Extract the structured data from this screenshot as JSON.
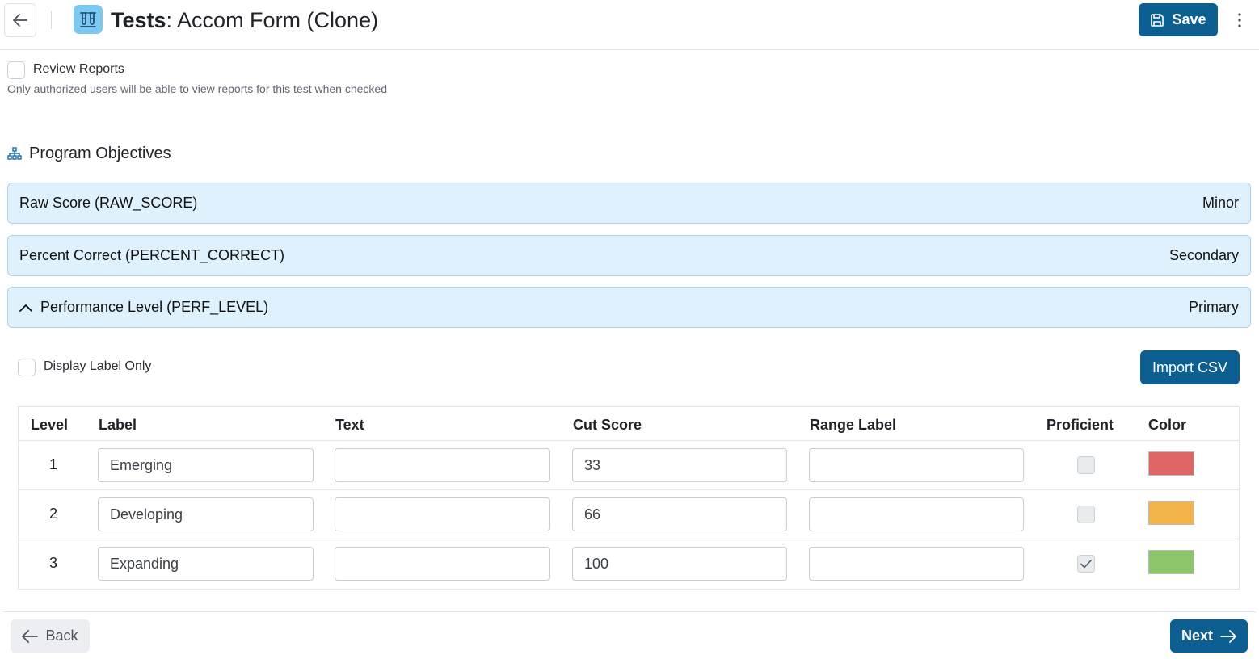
{
  "header": {
    "title_strong": "Tests",
    "title_rest": ": Accom Form (Clone)",
    "save_label": "Save"
  },
  "review": {
    "label": "Review Reports",
    "help": "Only authorized users will be able to view reports for this test when checked",
    "checked": false
  },
  "section": {
    "title": "Program Objectives"
  },
  "objectives": [
    {
      "name": "Raw Score (RAW_SCORE)",
      "rank": "Minor",
      "expanded": false
    },
    {
      "name": "Percent Correct (PERCENT_CORRECT)",
      "rank": "Secondary",
      "expanded": false
    },
    {
      "name": "Performance Level (PERF_LEVEL)",
      "rank": "Primary",
      "expanded": true
    }
  ],
  "display_label_only": {
    "label": "Display Label Only",
    "checked": false
  },
  "import_label": "Import CSV",
  "table": {
    "headers": {
      "level": "Level",
      "label": "Label",
      "text": "Text",
      "cut_score": "Cut Score",
      "range_label": "Range Label",
      "proficient": "Proficient",
      "color": "Color"
    },
    "rows": [
      {
        "level": "1",
        "label": "Emerging",
        "text": "",
        "cut_score": "33",
        "range_label": "",
        "proficient": false,
        "color": "#e06666"
      },
      {
        "level": "2",
        "label": "Developing",
        "text": "",
        "cut_score": "66",
        "range_label": "",
        "proficient": false,
        "color": "#f1b34a"
      },
      {
        "level": "3",
        "label": "Expanding",
        "text": "",
        "cut_score": "100",
        "range_label": "",
        "proficient": true,
        "color": "#8cc56a"
      }
    ]
  },
  "footer": {
    "back_label": "Back",
    "next_label": "Next"
  },
  "colors": {
    "primary": "#0d5f92",
    "objective_bg": "#dff1fc",
    "objective_border": "#a9d3ee"
  }
}
